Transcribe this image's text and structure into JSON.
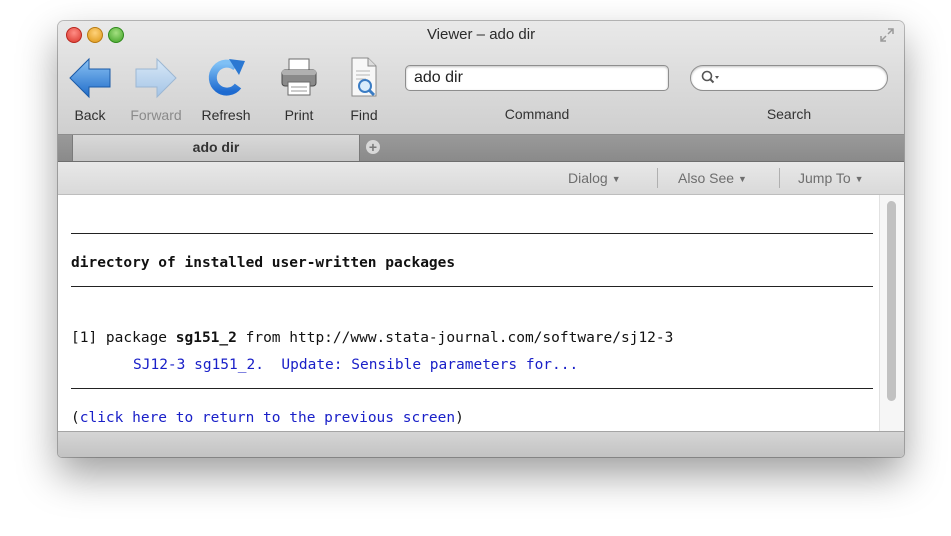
{
  "window": {
    "title": "Viewer – ado dir"
  },
  "toolbar": {
    "back_label": "Back",
    "forward_label": "Forward",
    "refresh_label": "Refresh",
    "print_label": "Print",
    "find_label": "Find",
    "command_value": "ado dir",
    "command_label": "Command",
    "search_value": "",
    "search_label": "Search",
    "icons": [
      "back-arrow-icon",
      "forward-arrow-icon",
      "refresh-icon",
      "printer-icon",
      "find-document-icon",
      "search-magnifier-icon"
    ]
  },
  "tabs": [
    {
      "label": "ado dir",
      "active": true
    }
  ],
  "nav": {
    "dialog": "Dialog",
    "also_see": "Also See",
    "jump_to": "Jump To"
  },
  "content": {
    "heading": "directory of installed user-written packages",
    "pkg_prefix": "[1] package ",
    "pkg_name": "sg151_2",
    "pkg_from": " from http://www.stata-journal.com/software/sj12-3",
    "pkg_desc": "SJ12-3 sg151_2.  Update: Sensible parameters for...",
    "return_open": "(",
    "return_link": "click here to return to the previous screen",
    "return_close": ")"
  },
  "colors": {
    "link_blue": "#1a20c8",
    "back_arrow": "#3a86d6",
    "close_red": "#d8352b",
    "minimize_yellow": "#dc9615",
    "maximize_green": "#3fa125"
  }
}
